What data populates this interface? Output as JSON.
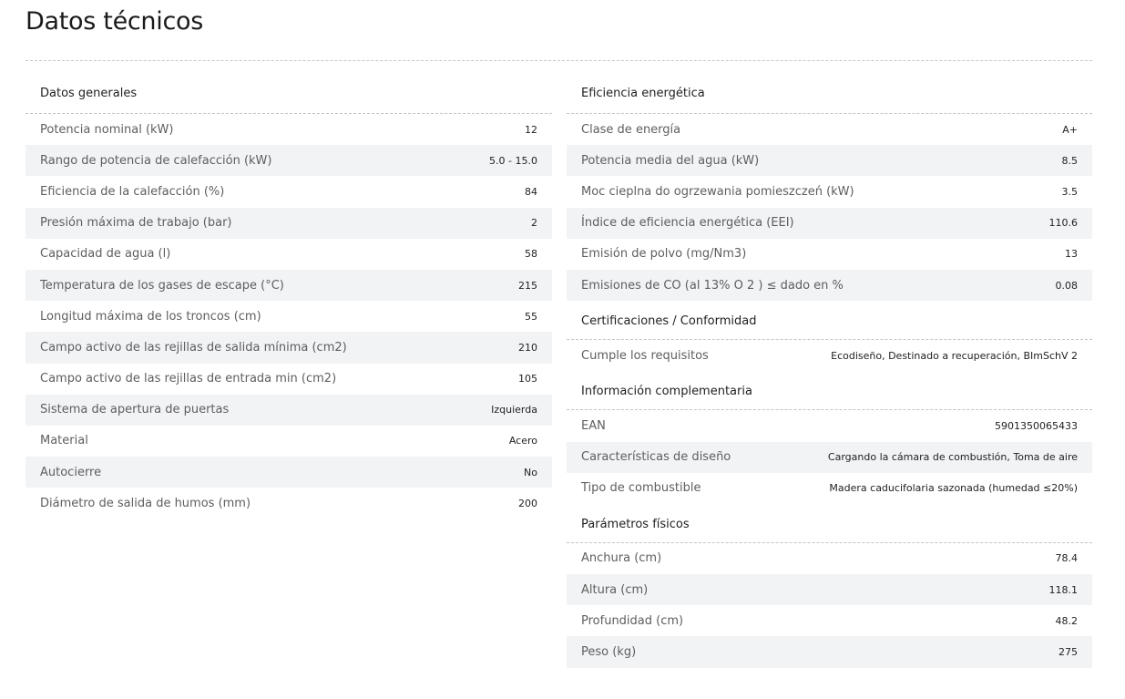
{
  "page": {
    "title": "Datos técnicos"
  },
  "general": {
    "heading": "Datos generales",
    "rows": [
      {
        "label": "Potencia nominal (kW)",
        "value": "12"
      },
      {
        "label": "Rango de potencia de calefacción (kW)",
        "value": "5.0 - 15.0"
      },
      {
        "label": "Eficiencia de la calefacción (%)",
        "value": "84"
      },
      {
        "label": "Presión máxima de trabajo (bar)",
        "value": "2"
      },
      {
        "label": "Capacidad de agua (l)",
        "value": "58"
      },
      {
        "label": "Temperatura de los gases de escape (°C)",
        "value": "215"
      },
      {
        "label": "Longitud máxima de los troncos (cm)",
        "value": "55"
      },
      {
        "label": "Campo activo de las rejillas de salida mínima (cm2)",
        "value": "210"
      },
      {
        "label": "Campo activo de las rejillas de entrada min (cm2)",
        "value": "105"
      },
      {
        "label": "Sistema de apertura de puertas",
        "value": "Izquierda"
      },
      {
        "label": "Material",
        "value": "Acero"
      },
      {
        "label": "Autocierre",
        "value": "No"
      },
      {
        "label": "Diámetro de salida de humos (mm)",
        "value": "200"
      }
    ]
  },
  "energy": {
    "heading": "Eficiencia energética",
    "rows": [
      {
        "label": "Clase de energía",
        "value": "A+"
      },
      {
        "label": "Potencia media del agua (kW)",
        "value": "8.5"
      },
      {
        "label": "Moc cieplna do ogrzewania pomieszczeń (kW)",
        "value": "3.5"
      },
      {
        "label": "Índice de eficiencia energética (EEI)",
        "value": "110.6"
      },
      {
        "label": "Emisión de polvo (mg/Nm3)",
        "value": "13"
      },
      {
        "label": "Emisiones de CO (al 13% O 2 ) ≤ dado en %",
        "value": "0.08"
      }
    ]
  },
  "certifications": {
    "heading": "Certificaciones / Conformidad",
    "rows": [
      {
        "label": "Cumple los requisitos",
        "value": "Ecodiseño, Destinado a recuperación, BImSchV 2"
      }
    ]
  },
  "complementary": {
    "heading": "Información complementaria",
    "rows": [
      {
        "label": "EAN",
        "value": "5901350065433"
      },
      {
        "label": "Características de diseño",
        "value": "Cargando la cámara de combustión, Toma de aire"
      },
      {
        "label": "Tipo de combustible",
        "value": "Madera caducifolaria sazonada (humedad ≤20%)"
      }
    ]
  },
  "physical": {
    "heading": "Parámetros físicos",
    "rows": [
      {
        "label": "Anchura (cm)",
        "value": "78.4"
      },
      {
        "label": "Altura (cm)",
        "value": "118.1"
      },
      {
        "label": "Profundidad (cm)",
        "value": "48.2"
      },
      {
        "label": "Peso (kg)",
        "value": "275"
      }
    ]
  }
}
